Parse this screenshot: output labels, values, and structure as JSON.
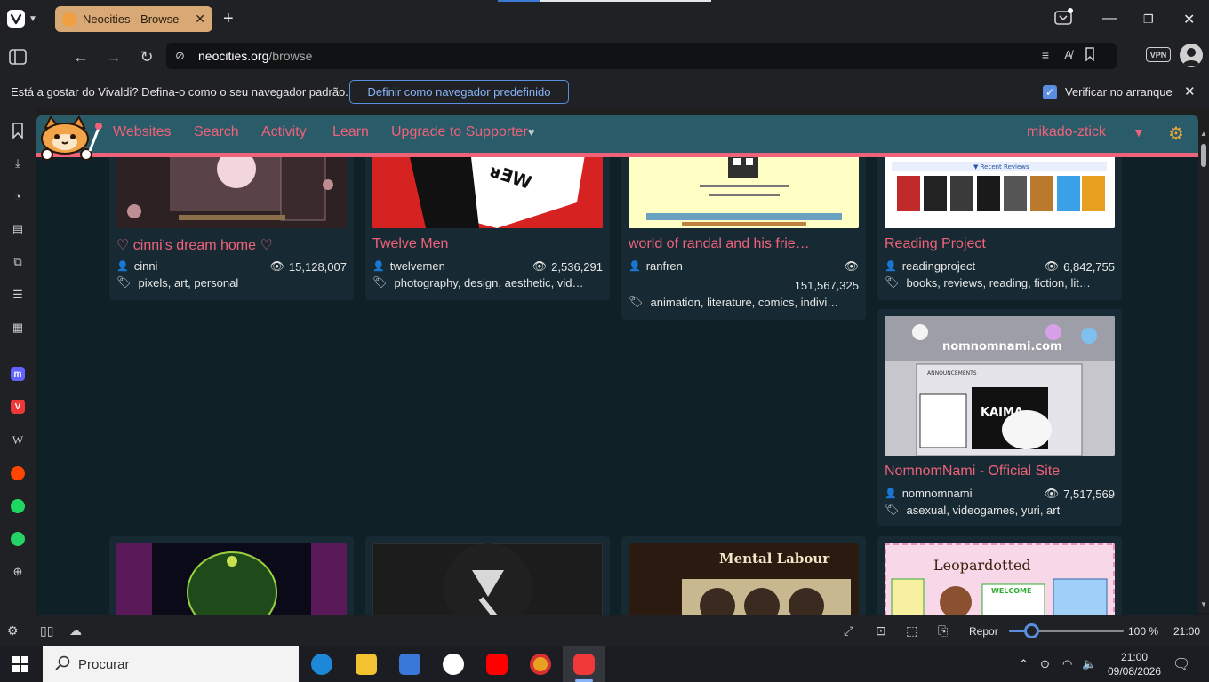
{
  "browser": {
    "tab": {
      "title": "Neocities - Browse",
      "favicon": "neocities-cat-icon"
    },
    "address": {
      "domain": "neocities.org",
      "path": "/browse"
    },
    "vpn_label": "VPN"
  },
  "notification": {
    "text": "Está a gostar do Vivaldi? Defina-o como o seu navegador padrão.",
    "button": "Definir como navegador predefinido",
    "checkbox_label": "Verificar no arranque",
    "checkbox_checked": true
  },
  "site_nav": {
    "links": [
      "Websites",
      "Search",
      "Activity",
      "Learn",
      "Upgrade to Supporter"
    ],
    "supporter_heart": "♥",
    "username": "mikado-ztick",
    "caret": "▼",
    "gear": "⚙"
  },
  "cards": [
    {
      "title": "♡ cinni's dream home ♡",
      "user": "cinni",
      "views": "15,128,007",
      "tags": "pixels, art, personal"
    },
    {
      "title": "Twelve Men",
      "user": "twelvemen",
      "views": "2,536,291",
      "tags": "photography, design, aesthetic, vid…"
    },
    {
      "title": "world of randal and his frie…",
      "user": "ranfren",
      "views": "151,567,325",
      "tags": "animation, literature, comics, indivi…"
    },
    {
      "title": "Reading Project",
      "user": "readingproject",
      "views": "6,842,755",
      "tags": "books, reviews, reading, fiction, lit…"
    },
    {
      "title": "NomnomNami - Official Site",
      "user": "nomnomnami",
      "views": "7,517,569",
      "tags": "asexual, videogames, yuri, art"
    }
  ],
  "thumb_texts": {
    "reading_banner": "▼ Recent Reviews",
    "nomnom_banner": "nomnomnami.com",
    "nomnom_announce": "ANNOUNCEMENTS",
    "kaima": "KAIMA",
    "mental_labour": "Mental Labour",
    "leopardotted": "Leopardotted",
    "welcome": "WELCOME"
  },
  "status_bar": {
    "zoom_label": "Repor",
    "zoom_value": "100 %",
    "zoom_fraction": 0.2,
    "clock": "21:00"
  },
  "taskbar": {
    "search_placeholder": "Procurar",
    "time": "21:00",
    "date": "09/08/2026"
  },
  "colors": {
    "accent_pink": "#f0627a",
    "site_nav_bg": "#2a5b69",
    "page_bg": "#0f2027",
    "card_bg": "#172a33",
    "tab_active": "#d8a875",
    "vivaldi_blue": "#5a8fe0"
  }
}
